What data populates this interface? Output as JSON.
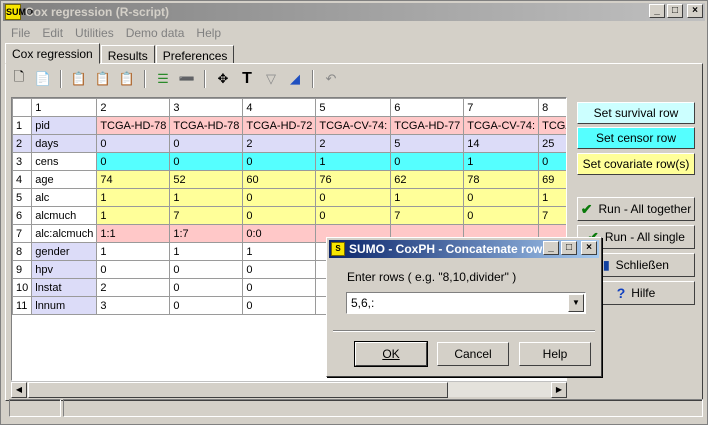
{
  "window": {
    "title": "Cox regression (R-script)",
    "icon_text": "SUMO"
  },
  "menu": [
    "File",
    "Edit",
    "Utilities",
    "Demo data",
    "Help"
  ],
  "tabs": [
    {
      "label": "Cox regression",
      "active": true
    },
    {
      "label": "Results",
      "active": false
    },
    {
      "label": "Preferences",
      "active": false
    }
  ],
  "grid": {
    "col_headers": [
      "",
      "1",
      "2",
      "3",
      "4",
      "5",
      "6",
      "7",
      "8"
    ],
    "rows": [
      {
        "num": "1",
        "name": "pid",
        "style": "white",
        "cells": [
          "TCGA-HD-78",
          "TCGA-HD-78",
          "TCGA-HD-72",
          "TCGA-CV-74:",
          "TCGA-HD-77",
          "TCGA-CV-74:",
          "TCGA-"
        ]
      },
      {
        "num": "2",
        "name": "days",
        "style": "blue",
        "cells": [
          "0",
          "0",
          "2",
          "2",
          "5",
          "14",
          "25"
        ]
      },
      {
        "num": "3",
        "name": "cens",
        "style": "cyan",
        "cells": [
          "0",
          "0",
          "0",
          "1",
          "0",
          "1",
          "0"
        ]
      },
      {
        "num": "4",
        "name": "age",
        "style": "yellow",
        "cells": [
          "74",
          "52",
          "60",
          "76",
          "62",
          "78",
          "69"
        ]
      },
      {
        "num": "5",
        "name": "alc",
        "style": "yellow",
        "cells": [
          "1",
          "1",
          "0",
          "0",
          "1",
          "0",
          "1"
        ]
      },
      {
        "num": "6",
        "name": "alcmuch",
        "style": "yellow",
        "cells": [
          "1",
          "7",
          "0",
          "0",
          "7",
          "0",
          "7"
        ]
      },
      {
        "num": "7",
        "name": "alc:alcmuch",
        "style": "pink",
        "cells": [
          "1:1",
          "1:7",
          "0:0",
          "",
          "",
          "",
          ""
        ]
      },
      {
        "num": "8",
        "name": "gender",
        "style": "white",
        "cells": [
          "1",
          "1",
          "1",
          "",
          "",
          "",
          ""
        ]
      },
      {
        "num": "9",
        "name": "hpv",
        "style": "white",
        "cells": [
          "0",
          "0",
          "0",
          "",
          "",
          "",
          ""
        ]
      },
      {
        "num": "10",
        "name": "lnstat",
        "style": "white",
        "cells": [
          "2",
          "0",
          "0",
          "",
          "",
          "",
          ""
        ]
      },
      {
        "num": "11",
        "name": "lnnum",
        "style": "white",
        "cells": [
          "3",
          "0",
          "0",
          "",
          "",
          "",
          ""
        ]
      }
    ]
  },
  "side_buttons": {
    "survival": "Set survival row",
    "censor": "Set censor row",
    "covariate": "Set covariate row(s)",
    "run_all_together": "Run - All together",
    "run_all_single": "Run - All single",
    "close": "Schließen",
    "help": "Hilfe"
  },
  "colors": {
    "survival": "#ccffff",
    "censor": "#55ffff",
    "covariate": "#ffff99"
  },
  "dialog": {
    "title": "SUMO - CoxPH - Concatenate rows",
    "label": "Enter rows ( e.g. \"8,10,divider\" )",
    "value": "5,6,:",
    "ok": "OK",
    "cancel": "Cancel",
    "help": "Help"
  }
}
